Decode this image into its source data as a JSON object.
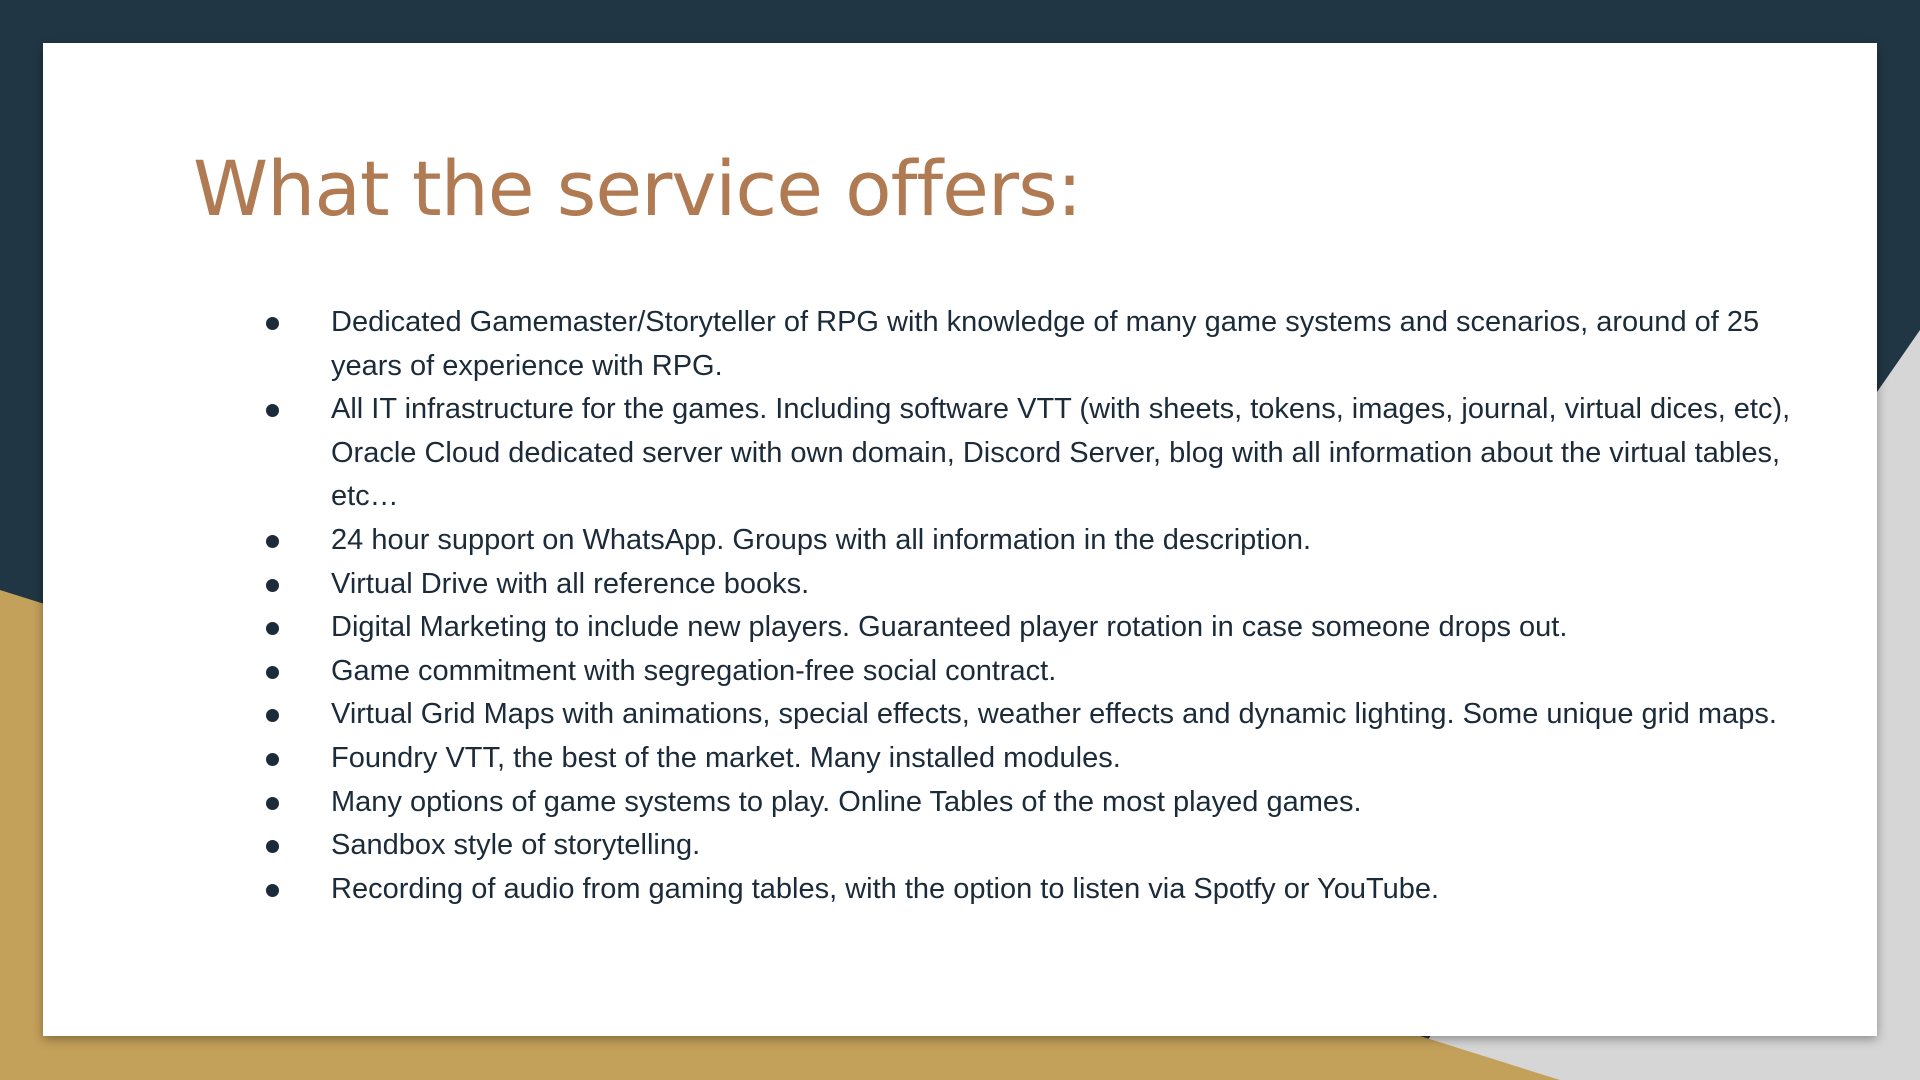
{
  "theme": {
    "background_dark": "#213644",
    "accent_gold": "#c4a15a",
    "accent_gray": "#d6d6d6",
    "title_color": "#b07a52",
    "text_color": "#1c2b39"
  },
  "slide": {
    "title": "What the service offers:",
    "bullets": [
      "Dedicated Gamemaster/Storyteller of RPG with knowledge of many game systems and scenarios, around of 25 years of experience with RPG.",
      "All IT infrastructure for the games. Including software VTT (with sheets, tokens, images, journal, virtual dices, etc), Oracle Cloud dedicated server with own domain, Discord Server, blog with all information about the virtual tables, etc…",
      "24 hour support on WhatsApp. Groups with all information in the description.",
      "Virtual Drive with all reference books.",
      "Digital Marketing to include new players. Guaranteed player rotation in case someone drops out.",
      "Game commitment with segregation-free social contract.",
      "Virtual Grid Maps with animations, special effects, weather effects and dynamic lighting. Some unique grid maps.",
      "Foundry VTT, the best of the market. Many installed modules.",
      "Many options of game systems to play. Online Tables of the most played games.",
      "Sandbox style of storytelling.",
      "Recording of audio from gaming tables, with the option to listen via Spotfy or YouTube."
    ]
  }
}
